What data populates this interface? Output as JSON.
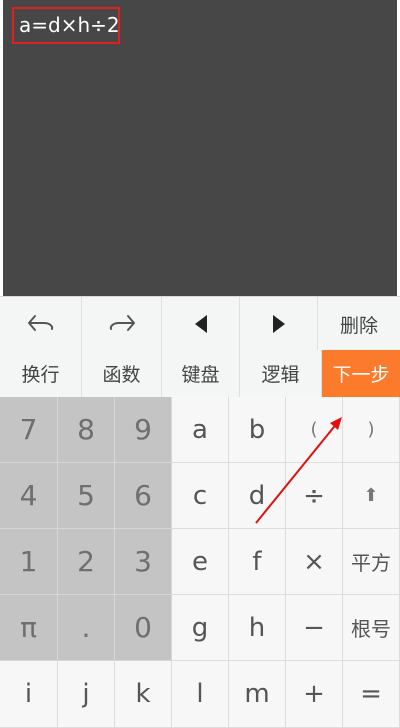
{
  "display": {
    "formula": "a=d×h÷2"
  },
  "toolbar": {
    "items": [
      {
        "name": "undo-button",
        "icon": "undo-icon"
      },
      {
        "name": "redo-button",
        "icon": "redo-icon"
      },
      {
        "name": "cursor-left-button",
        "icon": "triangle-left-icon"
      },
      {
        "name": "cursor-right-button",
        "icon": "triangle-right-icon"
      },
      {
        "name": "delete-button",
        "label": "删除"
      }
    ]
  },
  "tabs": [
    "换行",
    "函数",
    "键盘",
    "逻辑",
    "下一步"
  ],
  "keys": [
    [
      "7",
      "8",
      "9",
      "a",
      "b",
      "(",
      ")"
    ],
    [
      "4",
      "5",
      "6",
      "c",
      "d",
      "÷",
      "⬆"
    ],
    [
      "1",
      "2",
      "3",
      "e",
      "f",
      "×",
      "平方"
    ],
    [
      "π",
      ".",
      "0",
      "g",
      "h",
      "−",
      "根号"
    ],
    [
      "i",
      "j",
      "k",
      "l",
      "m",
      "+",
      "="
    ]
  ],
  "colors": {
    "display_bg": "#474747",
    "accent": "#fb7a2c",
    "numpad_bg": "#c4c4c4",
    "highlight_border": "#e02020"
  }
}
